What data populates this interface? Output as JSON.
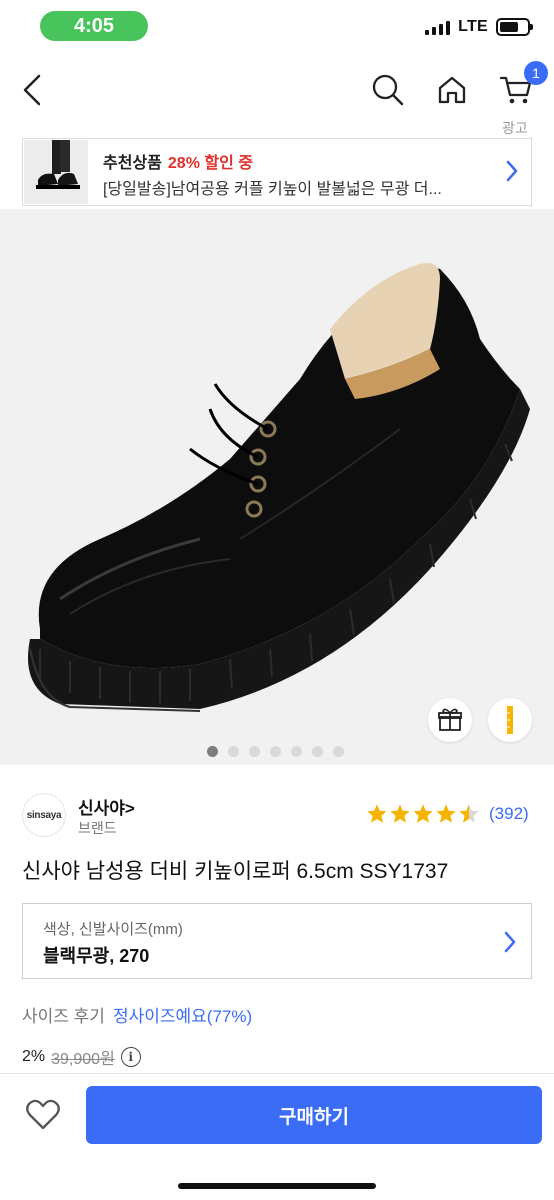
{
  "status_bar": {
    "time": "4:05",
    "network": "LTE"
  },
  "nav": {
    "cart_count": "1",
    "ad_label": "광고"
  },
  "ad_banner": {
    "tag": "추천상품",
    "discount": "28% 할인 중",
    "text": "[당일발송]남여공용 커플 키높이 발볼넓은 무광 더..."
  },
  "gallery": {
    "total_images": 7,
    "current_index": 1
  },
  "brand": {
    "logo_text": "sinsaya",
    "name": "신사야>",
    "subtitle": "브랜드"
  },
  "rating": {
    "stars": 4.5,
    "count": "(392)"
  },
  "product": {
    "title": "신사야 남성용 더비 키높이로퍼 6.5cm SSY1737"
  },
  "option": {
    "label": "색상, 신발사이즈(mm)",
    "value": "블랙무광, 270"
  },
  "size_review": {
    "label": "사이즈 후기",
    "value": "정사이즈예요(77%)"
  },
  "price": {
    "discount_percent": "2%",
    "original": "39,900원"
  },
  "bottom": {
    "buy_label": "구매하기"
  },
  "colors": {
    "accent": "#3b6cf6",
    "sale_red": "#e0312c",
    "star": "#f5b400",
    "status_green": "#49c45c"
  },
  "icons": [
    "back-icon",
    "search-icon",
    "home-icon",
    "cart-icon",
    "gift-icon",
    "ruler-icon",
    "heart-icon",
    "info-icon",
    "chevron-right-icon",
    "star-icon"
  ]
}
